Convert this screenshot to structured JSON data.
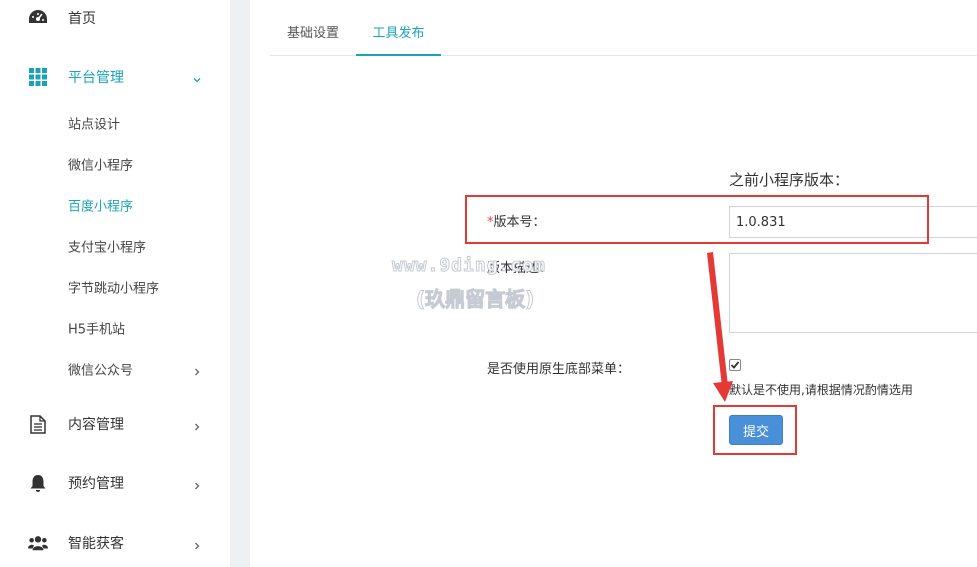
{
  "sidebar": {
    "items": [
      {
        "label": "首页",
        "icon": "dashboard-icon"
      },
      {
        "label": "平台管理",
        "icon": "grid-icon",
        "expanded": true
      },
      {
        "label": "内容管理",
        "icon": "document-icon"
      },
      {
        "label": "预约管理",
        "icon": "bell-icon"
      },
      {
        "label": "智能获客",
        "icon": "users-icon"
      }
    ],
    "sub_items": [
      {
        "label": "站点设计"
      },
      {
        "label": "微信小程序"
      },
      {
        "label": "百度小程序"
      },
      {
        "label": "支付宝小程序"
      },
      {
        "label": "字节跳动小程序"
      },
      {
        "label": "H5手机站"
      },
      {
        "label": "微信公众号"
      }
    ],
    "active_color": "#1aa3b8"
  },
  "tabs": [
    {
      "label": "基础设置"
    },
    {
      "label": "工具发布"
    }
  ],
  "form": {
    "prev_version_label": "之前小程序版本：",
    "version_required_mark": "*",
    "version_label": "版本号：",
    "version_value": "1.0.831",
    "desc_label": "版本描述：",
    "native_menu_label": "是否使用原生底部菜单：",
    "native_menu_checked": true,
    "native_menu_hint": "默认是不使用,请根据情况酌情选用",
    "submit_label": "提交"
  },
  "watermark": {
    "line1": "www.9ding.com",
    "line2": "(玖鼎留言板)"
  },
  "annotation_color": "#e53935"
}
